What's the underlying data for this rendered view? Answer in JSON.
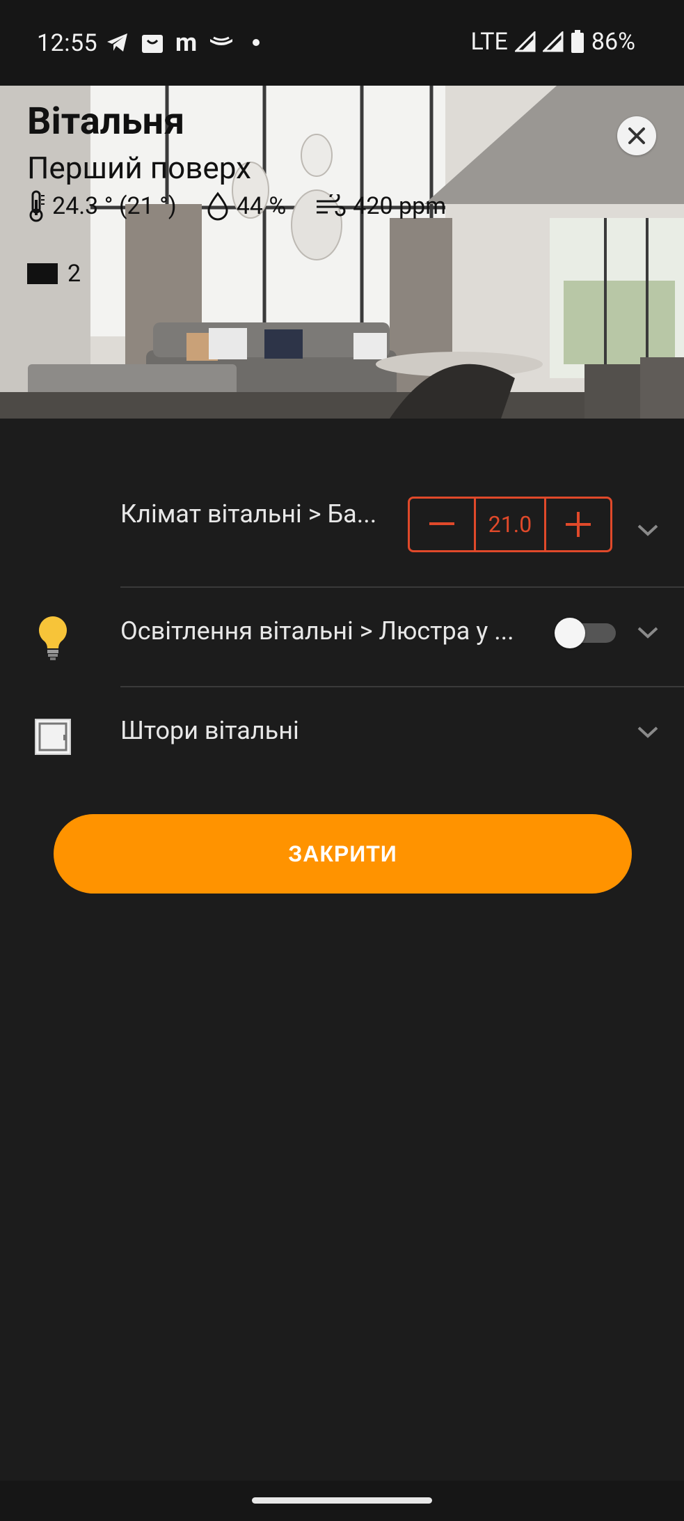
{
  "status_bar": {
    "time": "12:55",
    "network": "LTE",
    "battery": "86%",
    "notification_icons": [
      "telegram-icon",
      "shopping-bag-icon",
      "m-app-icon",
      "cloud-icon"
    ]
  },
  "room": {
    "name": "Вітальня",
    "floor": "Перший поверх",
    "temperature": "24.3 ° (21 °)",
    "humidity": "44 %",
    "co2": "420 ppm",
    "device_count": "2"
  },
  "items": [
    {
      "label": "Клімат вітальні > Ба...",
      "setpoint": "21.0",
      "icon": "none"
    },
    {
      "label": "Освітлення вітальні > Люстра у ...",
      "icon": "lightbulb-icon",
      "state": "off"
    },
    {
      "label": "Штори вітальні",
      "icon": "window-icon"
    }
  ],
  "close_button": "ЗАКРИТИ",
  "colors": {
    "accent": "#ff9300",
    "stepper": "#e0492a",
    "background": "#1c1c1c"
  }
}
